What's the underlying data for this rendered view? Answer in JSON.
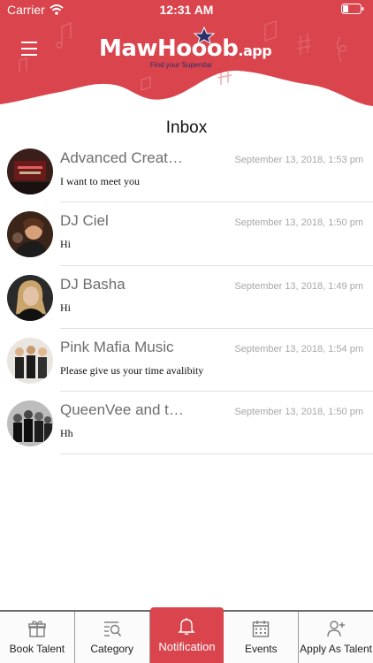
{
  "status_bar": {
    "carrier": "Carrier",
    "time": "12:31 AM"
  },
  "header": {
    "logo_main": "MawHooob",
    "logo_suffix": ".app",
    "logo_tagline": "Find your Superstar",
    "brand_color": "#d9444d"
  },
  "page": {
    "title": "Inbox"
  },
  "conversations": [
    {
      "name": "Advanced Creat…",
      "date": "September 13, 2018, 1:53 pm",
      "message": "I want to meet you",
      "avatar_icon": "advanced-creations-avatar"
    },
    {
      "name": "DJ Ciel",
      "date": "September 13, 2018, 1:50 pm",
      "message": "Hi",
      "avatar_icon": "dj-ciel-avatar"
    },
    {
      "name": "DJ Basha",
      "date": "September 13, 2018, 1:49 pm",
      "message": "Hi",
      "avatar_icon": "dj-basha-avatar"
    },
    {
      "name": "Pink Mafia Music",
      "date": "September 13, 2018, 1:54 pm",
      "message": "Please give us your time avalibity",
      "avatar_icon": "pink-mafia-avatar"
    },
    {
      "name": "QueenVee and t…",
      "date": "September 13, 2018, 1:50 pm",
      "message": "Hh",
      "avatar_icon": "queenvee-avatar"
    }
  ],
  "tabbar": {
    "active": "Notification",
    "tabs": [
      {
        "label": "Book Talent",
        "icon": "gift-icon"
      },
      {
        "label": "Category",
        "icon": "category-search-icon"
      },
      {
        "label": "Notification",
        "icon": "bell-icon"
      },
      {
        "label": "Events",
        "icon": "calendar-icon"
      },
      {
        "label": "Apply As Talent",
        "icon": "add-user-icon"
      }
    ]
  }
}
